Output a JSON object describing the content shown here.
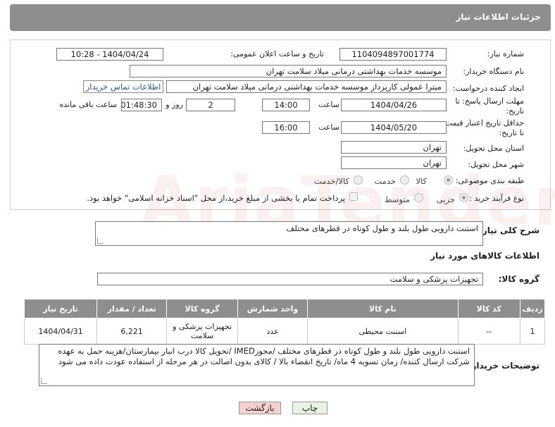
{
  "header": {
    "title": "جزئیات اطلاعات نیاز"
  },
  "fields": {
    "need_number": {
      "label": "شماره نیاز:",
      "value": "1104094897001774"
    },
    "announce": {
      "label": "تاریخ و ساعت اعلان عمومی:",
      "value": "1404/04/24 - 10:28"
    },
    "buyer_org": {
      "label": "نام دستگاه خریدار:",
      "value": "موسسه خدمات بهداشتی درمانی میلاد سلامت تهران"
    },
    "requester": {
      "label": "ایجاد کننده درخواست:",
      "value": "میترا عمولی کارپرداز موسسه خدمات بهداشتی درمانی میلاد سلامت تهران",
      "contact_link": "اطلاعات تماس خریدار"
    },
    "reply_deadline": {
      "label_line1": "مهلت ارسال پاسخ: تا",
      "label_line2": "تاریخ:",
      "date": "1404/04/26",
      "time_label": "ساعت",
      "time": "14:00",
      "days": "2",
      "days_label": "روز و",
      "remaining": "01:48:30",
      "remaining_label": "ساعت باقی مانده"
    },
    "price_validity": {
      "label_line1": "حداقل تاریخ اعتبار قیمت:",
      "label_line2": "تا تاریخ:",
      "date": "1404/05/20",
      "time_label": "ساعت",
      "time": "16:00"
    },
    "province": {
      "label": "استان محل تحویل:",
      "value": "تهران"
    },
    "city": {
      "label": "شهر محل تحویل:",
      "value": "تهران"
    },
    "category": {
      "label": "طبقه بندی موضوعی:",
      "options": [
        "کالا",
        "خدمت",
        "کالا/خدمت"
      ],
      "selected": "کالا"
    },
    "process": {
      "label": "نوع فرآیند خرید :",
      "options": [
        "جزیی",
        "متوسط"
      ],
      "selected": "جزیی",
      "note": "پرداخت تمام یا بخشی از مبلغ خرید،از محل \"اسناد خزانه اسلامی\" خواهد بود."
    }
  },
  "summary": {
    "label": "شرح کلی نیاز:",
    "value": "استنت دارویی طول بلند و طول کوتاه در قطرهای مختلف"
  },
  "goods_section": {
    "title": "اطلاعات کالاهای مورد نیاز"
  },
  "goods_group": {
    "label": "گروه کالا:",
    "value": "تجهیزات پزشکی و سلامت"
  },
  "table": {
    "headers": [
      "ردیف",
      "کد کالا",
      "نام کالا",
      "واحد شمارش",
      "گروه کالا",
      "تعداد / مقدار",
      "تاریخ نیاز"
    ],
    "rows": [
      [
        "1",
        "--",
        "استنت محیطی",
        "عدد",
        "تجهیزات پزشکی و سلامت",
        "6,221",
        "1404/04/31"
      ]
    ]
  },
  "buyer_notes": {
    "label": "توضیحات خریدار:",
    "value": "استنت دارویی طول بلند و طول کوتاه در قطرهای مختلف  /مجوزIMED /تحویل کالا درب انبار بیمارستان/هزینه حمل به عهده شرکت ارسال کننده/ زمان تسویه 4 ماه/ تاریخ انقضاء بالا / کالای بدون اصالت در هر مرحله از استفاده عودت داده می شود"
  },
  "buttons": {
    "print": "چاپ",
    "back": "بازگشت"
  },
  "watermark": {
    "text": "AriaTender.neT"
  },
  "colors": {
    "header_bg": "#8e8e8e",
    "link": "#1a56c5",
    "back_bg": "#f7d0d0",
    "print_bg": "#e8f5e2"
  }
}
